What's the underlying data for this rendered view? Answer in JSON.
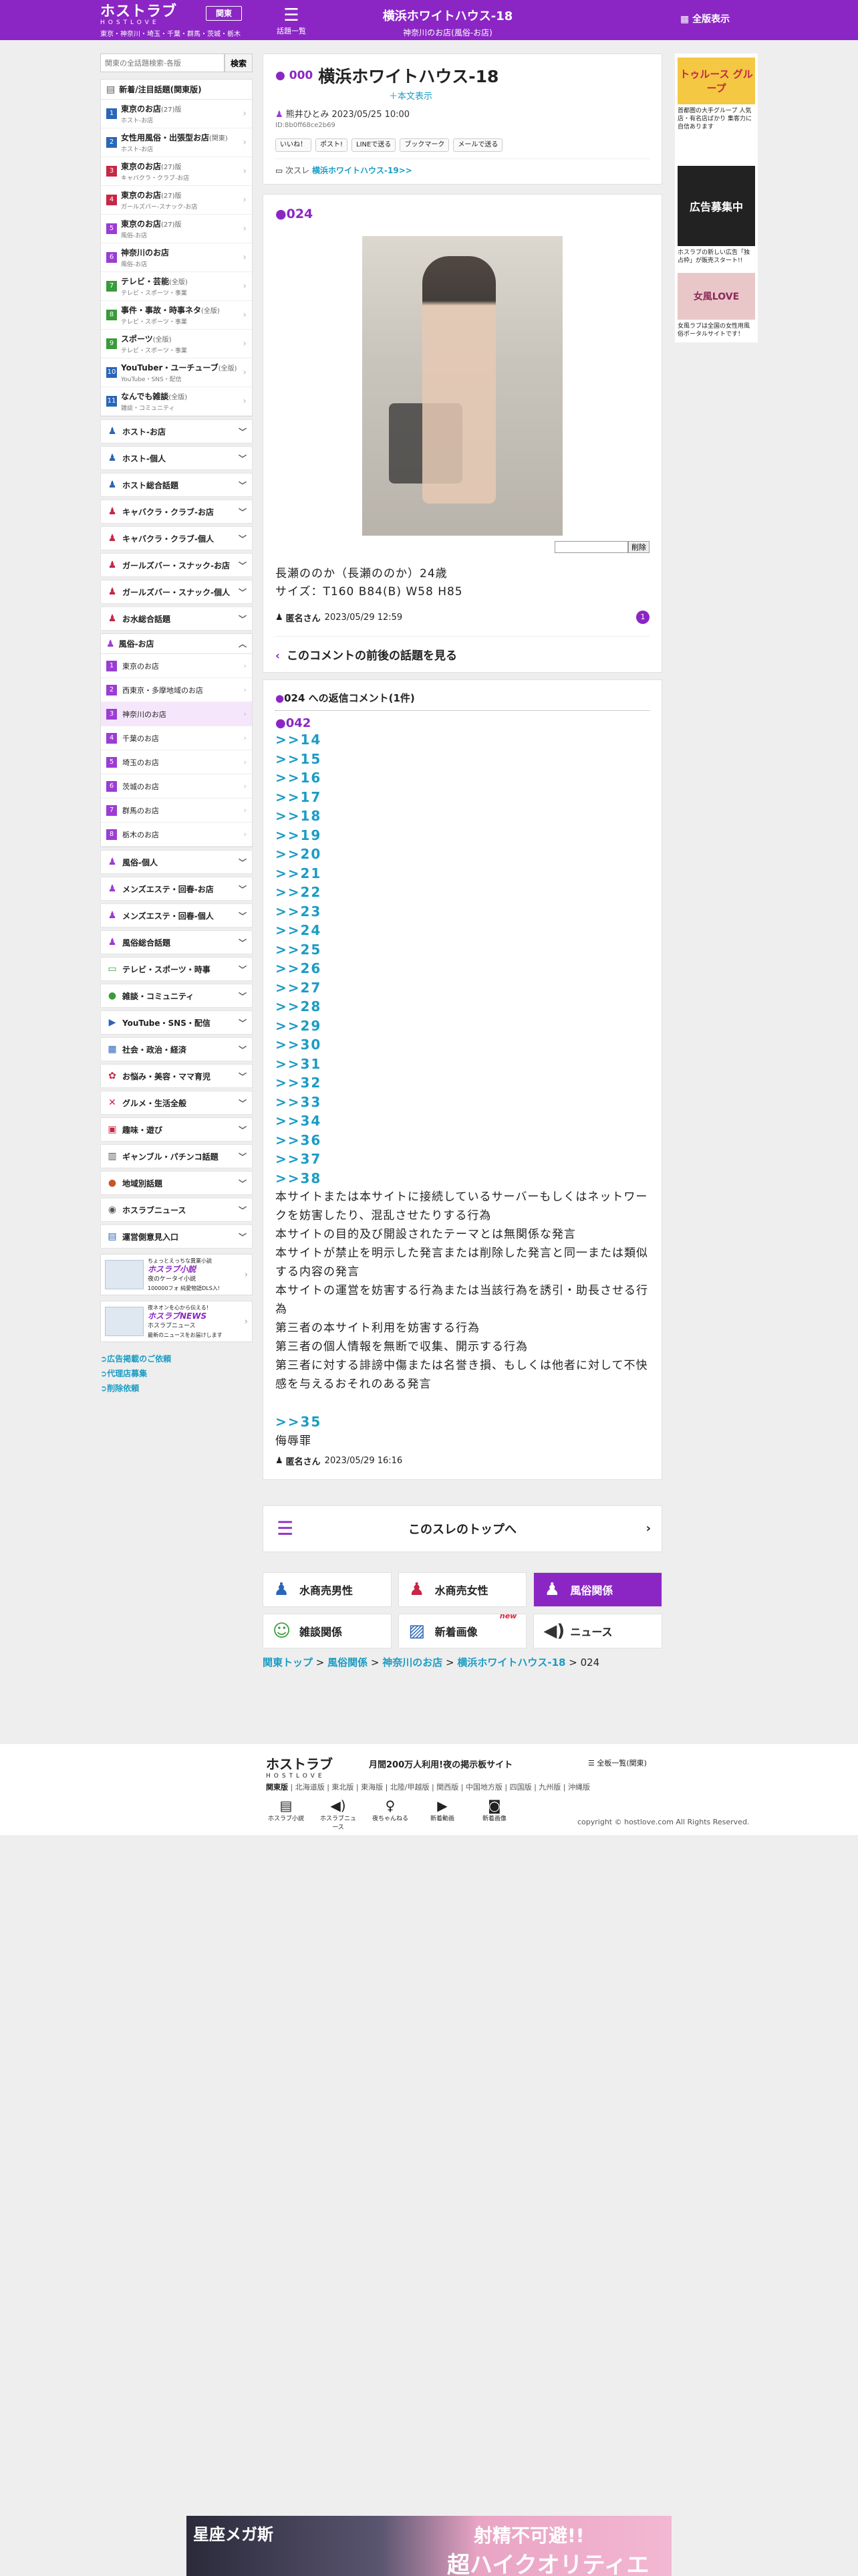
{
  "header": {
    "logo_jp": "ホストラブ",
    "logo_en": "HOSTLOVE",
    "areas": "東京・神奈川・埼玉・千葉・群馬・茨城・栃木",
    "region_button": "関東",
    "board_list_label": "話題一覧",
    "title": "横浜ホワイトハウス-18",
    "subtitle": "神奈川のお店(風俗-お店)",
    "full_view": "全版表示"
  },
  "search": {
    "placeholder": "関東の全話題検索-各版",
    "button": "検索"
  },
  "sidebar": {
    "new_head": "新着/注目話題(関東版)",
    "new_items": [
      {
        "num": "1",
        "title": "東京のお店",
        "count": "(27)版",
        "sub": "ホスト-お店",
        "color": "#2a66b8"
      },
      {
        "num": "2",
        "title": "女性用風俗・出張型お店",
        "count": "(関東)",
        "sub": "ホスト-お店",
        "color": "#2a66b8"
      },
      {
        "num": "3",
        "title": "東京のお店",
        "count": "(27)版",
        "sub": "キャバクラ・クラブ-お店",
        "color": "#c62845"
      },
      {
        "num": "4",
        "title": "東京のお店",
        "count": "(27)版",
        "sub": "ガールズバー-スナック-お店",
        "color": "#c62845"
      },
      {
        "num": "5",
        "title": "東京のお店",
        "count": "(27)版",
        "sub": "風俗-お店",
        "color": "#9b3dd3"
      },
      {
        "num": "6",
        "title": "神奈川のお店",
        "count": "",
        "sub": "風俗-お店",
        "color": "#9b3dd3"
      },
      {
        "num": "7",
        "title": "テレビ・芸能",
        "count": "(全版)",
        "sub": "テレビ・スポーツ・事業",
        "color": "#3a9b3a"
      },
      {
        "num": "8",
        "title": "事件・事故・時事ネタ",
        "count": "(全版)",
        "sub": "テレビ・スポーツ・事業",
        "color": "#3a9b3a"
      },
      {
        "num": "9",
        "title": "スポーツ",
        "count": "(全版)",
        "sub": "テレビ・スポーツ・事業",
        "color": "#3a9b3a"
      },
      {
        "num": "10",
        "title": "YouTuber・ユーチューブ",
        "count": "(全版)",
        "sub": "YouTube・SNS・配信",
        "color": "#2a66b8"
      },
      {
        "num": "11",
        "title": "なんでも雑談",
        "count": "(全版)",
        "sub": "雑談・コミュニティ",
        "color": "#2a66b8"
      }
    ],
    "cats_a": [
      {
        "label": "ホスト-お店",
        "icon": "♟",
        "color": "#2a66b8"
      },
      {
        "label": "ホスト-個人",
        "icon": "♟",
        "color": "#2a66b8"
      },
      {
        "label": "ホスト総合話題",
        "icon": "♟",
        "color": "#2a66b8"
      },
      {
        "label": "キャバクラ・クラブ-お店",
        "icon": "♟",
        "color": "#c62845"
      },
      {
        "label": "キャバクラ・クラブ-個人",
        "icon": "♟",
        "color": "#c62845"
      },
      {
        "label": "ガールズバー・スナック-お店",
        "icon": "♟",
        "color": "#c62845"
      },
      {
        "label": "ガールズバー・スナック-個人",
        "icon": "♟",
        "color": "#c62845"
      },
      {
        "label": "お水総合話題",
        "icon": "♟",
        "color": "#c62845"
      }
    ],
    "fuzoku_head": "風俗-お店",
    "fuzoku_items": [
      {
        "num": "1",
        "label": "東京のお店"
      },
      {
        "num": "2",
        "label": "西東京・多摩地域のお店"
      },
      {
        "num": "3",
        "label": "神奈川のお店"
      },
      {
        "num": "4",
        "label": "千葉のお店"
      },
      {
        "num": "5",
        "label": "埼玉のお店"
      },
      {
        "num": "6",
        "label": "茨城のお店"
      },
      {
        "num": "7",
        "label": "群馬のお店"
      },
      {
        "num": "8",
        "label": "栃木のお店"
      }
    ],
    "cats_b": [
      {
        "label": "風俗-個人",
        "icon": "♟",
        "color": "#9b3dd3"
      },
      {
        "label": "メンズエステ・回春-お店",
        "icon": "♟",
        "color": "#9b3dd3"
      },
      {
        "label": "メンズエステ・回春-個人",
        "icon": "♟",
        "color": "#9b3dd3"
      },
      {
        "label": "風俗総合話題",
        "icon": "♟",
        "color": "#9b3dd3"
      },
      {
        "label": "テレビ・スポーツ・時事",
        "icon": "▭",
        "color": "#3a9b3a"
      },
      {
        "label": "雑談・コミュニティ",
        "icon": "●",
        "color": "#3a9b3a"
      },
      {
        "label": "YouTube・SNS・配信",
        "icon": "▶",
        "color": "#2a66b8"
      },
      {
        "label": "社会・政治・経済",
        "icon": "▦",
        "color": "#2a66b8"
      },
      {
        "label": "お悩み・美容・ママ育児",
        "icon": "✿",
        "color": "#c62845"
      },
      {
        "label": "グルメ・生活全般",
        "icon": "✕",
        "color": "#c62845"
      },
      {
        "label": "趣味・遊び",
        "icon": "▣",
        "color": "#c62845"
      },
      {
        "label": "ギャンブル・パチンコ話題",
        "icon": "▥",
        "color": "#555555"
      },
      {
        "label": "地域別話題",
        "icon": "●",
        "color": "#c65528"
      },
      {
        "label": "ホスラブニュース",
        "icon": "◉",
        "color": "#555555"
      },
      {
        "label": "運営側意見入口",
        "icon": "▤",
        "color": "#2a66b8"
      }
    ],
    "banner1": {
      "top": "ちょっとえっちな異業小説",
      "name": "ホスラブ小説",
      "line": "夜のケータイ小説",
      "sub": "100000フォ 純愛物語DLS入!"
    },
    "banner2": {
      "top": "夜ネオンを心から伝える!",
      "name": "ホスラブNEWS",
      "line": "ホスラブニュース",
      "sub": "最新のニュースをお届けします"
    },
    "links": [
      "広告掲載のご依頼",
      "代理店募集",
      "削除依頼"
    ]
  },
  "topic": {
    "num": "000",
    "title": "横浜ホワイトハウス-18",
    "body_link": "＋本文表示",
    "author": "熊井ひとみ 2023/05/25 10:00",
    "author_id": "ID:8b0ff68ce2b69",
    "share": [
      "いいね！",
      "ポスト!",
      "LINEで送る",
      "ブックマーク",
      "メールで送る"
    ],
    "next_label": "次スレ",
    "next_link": "横浜ホワイトハウス-19>>"
  },
  "post": {
    "num": "024",
    "report_button": "削除",
    "body_line1": "長瀬ののか（長瀬ののか）24歳",
    "body_line2": "サイズ：T160 B84(B) W58 H85",
    "name": "匿名さん",
    "date": "2023/05/29 12:59",
    "reply_count": "1",
    "context_link": "このコメントの前後の話題を見る"
  },
  "replies": {
    "head_num": "024",
    "head_text": " への返信コメント(1件)",
    "num": "042",
    "anchors": [
      ">>14",
      ">>15",
      ">>16",
      ">>17",
      ">>18",
      ">>19",
      ">>20",
      ">>21",
      ">>22",
      ">>23",
      ">>24",
      ">>25",
      ">>26",
      ">>27",
      ">>28",
      ">>29",
      ">>30",
      ">>31",
      ">>32",
      ">>33",
      ">>34",
      ">>36",
      ">>37",
      ">>38"
    ],
    "rules": [
      "本サイトまたは本サイトに接続しているサーバーもしくはネットワークを妨害したり、混乱させたりする行為",
      "本サイトの目的及び開設されたテーマとは無関係な発言",
      "本サイトが禁止を明示した発言または削除した発言と同一または類似する内容の発言",
      "本サイトの運営を妨害する行為または当該行為を誘引・助長させる行為",
      "第三者の本サイト利用を妨害する行為",
      "第三者の個人情報を無断で収集、開示する行為",
      "第三者に対する誹謗中傷または名誉き損、もしくは他者に対して不快感を与えるおそれのある発言"
    ],
    "last_anchor": ">>35",
    "last_text": "侮辱罪",
    "name": "匿名さん",
    "date": "2023/05/29 16:16"
  },
  "to_top": "このスレのトップへ",
  "categories": [
    {
      "label": "水商売男性",
      "icon": "♟",
      "color": "#2a66b8",
      "active": false,
      "new": ""
    },
    {
      "label": "水商売女性",
      "icon": "♟",
      "color": "#c62845",
      "active": false,
      "new": ""
    },
    {
      "label": "風俗関係",
      "icon": "♟",
      "color": "#ffffff",
      "active": true,
      "new": ""
    },
    {
      "label": "雑談関係",
      "icon": "☺",
      "color": "#3a9b3a",
      "active": false,
      "new": ""
    },
    {
      "label": "新着画像",
      "icon": "▨",
      "color": "#2a66b8",
      "active": false,
      "new": "new"
    },
    {
      "label": "ニュース",
      "icon": "◀)",
      "color": "#333333",
      "active": false,
      "new": ""
    }
  ],
  "breadcrumb": [
    "関東トップ",
    "風俗関係",
    "神奈川のお店",
    "横浜ホワイトハウス-18",
    "024"
  ],
  "right_ads": [
    {
      "title": "トゥルース グループ",
      "text": "首都圏の大手グループ 人気店・有名店ばかり 集客力に自信あります",
      "bg": "#f4c842"
    },
    {
      "title": "広告募集中",
      "text": "ホスラブの新しい広告「独占枠」が販売スタート!!",
      "bg": "#222222"
    },
    {
      "title": "女風LOVE",
      "text": "女風ラブは全国の女性用風俗ポータルサイトです！",
      "bg": "#e9c7c9"
    }
  ],
  "footer": {
    "logo_jp": "ホストラブ",
    "logo_en": "HOSTLOVE",
    "tagline": "月間200万人利用!夜の掲示板サイト",
    "all_boards": "全板一覧(関東)",
    "regions_current": "関東版",
    "regions": "北海道版 | 東北版 | 東海版 | 北陸/甲越版 | 関西版 | 中国地方版 | 四国版 | 九州版 | 沖縄版",
    "icons": [
      "ホスラブ小説",
      "ホスラブニュース",
      "夜ちゃんねる",
      "新着動画",
      "新着画像"
    ],
    "copyright": "copyright © hostlove.com All Rights Reserved."
  },
  "bottom_ad": {
    "left": "星座メガ斯",
    "right1": "射精不可避!!",
    "right2": "超ハイクオリティエロゲ"
  }
}
